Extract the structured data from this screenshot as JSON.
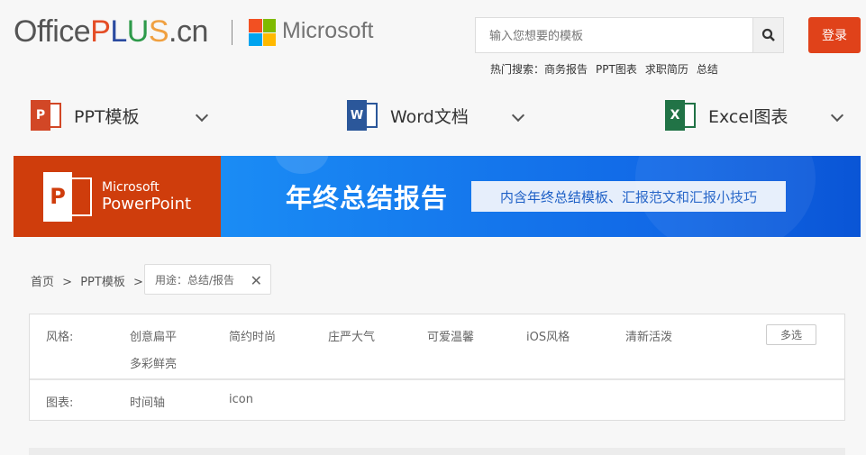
{
  "header": {
    "logo_text": "OfficePLUS.cn",
    "brand": "Microsoft",
    "search_placeholder": "输入您想要的模板",
    "login": "登录",
    "hot_label": "热门搜索：",
    "hot_terms": [
      "商务报告",
      "PPT图表",
      "求职简历",
      "总结"
    ]
  },
  "nav": [
    {
      "label": "PPT模板",
      "color": "#d24726"
    },
    {
      "label": "Word文档",
      "color": "#2b579a"
    },
    {
      "label": "Excel图表",
      "color": "#217346"
    }
  ],
  "banner": {
    "ms": "Microsoft",
    "product": "PowerPoint",
    "title": "年终总结报告",
    "subtitle": "内含年终总结模板、汇报范文和汇报小技巧"
  },
  "breadcrumb": {
    "home": "首页",
    "ppt": "PPT模板",
    "sep": ">",
    "tag": "用途：总结/报告"
  },
  "filters": {
    "style_label": "风格:",
    "styles": [
      "创意扁平",
      "简约时尚",
      "庄严大气",
      "可爱温馨",
      "iOS风格",
      "清新活泼",
      "多彩鲜亮"
    ],
    "multi": "多选",
    "chart_label": "图表:",
    "charts": [
      "时间轴",
      "icon"
    ]
  }
}
